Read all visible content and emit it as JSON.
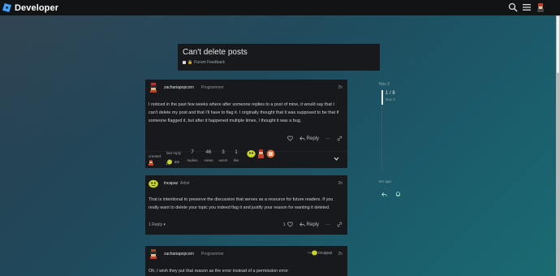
{
  "header": {
    "brand": "Developer",
    "icons": [
      "search-icon",
      "hamburger-menu-icon",
      "user-avatar"
    ]
  },
  "topic": {
    "title": "Can't delete posts",
    "category": "Forum Feedback"
  },
  "posts": [
    {
      "username": "zachariapopcorn",
      "user_title": "Programmer",
      "time": "2h",
      "body": "I noticed in the past few weeks where after someone replies to a post of mine, it would say that I can't delete my post and that I'll have to flag it. I originally thought that it was supposed to be that if someone flagged it, but after it happened multiple times, I thought it was a bug.",
      "reply_label": "Reply"
    },
    {
      "username": "incapaz",
      "user_title": "Artist",
      "time": "2h",
      "body": "That is intentional to preserve the discussion that serves as a resource for future readers. If you really want to delete your topic you indeed flag it and justify your reason for wanting it deleted.",
      "replies_toggle": "1 Reply",
      "like_count": "1",
      "reply_label": "Reply"
    },
    {
      "username": "zachariapopcorn",
      "user_title": "Programmer",
      "time": "2h",
      "reply_to": "incapaz",
      "body": "Oh, I wish they put that reason as the error instead of a permission error"
    }
  ],
  "topic_meta": {
    "created_label": "created",
    "created_time": "1h",
    "last_reply_label": "last reply",
    "last_reply_time": "6m",
    "stats": [
      {
        "value": "7",
        "label": "replies"
      },
      {
        "value": "46",
        "label": "views"
      },
      {
        "value": "3",
        "label": "users"
      },
      {
        "value": "1",
        "label": "like"
      }
    ]
  },
  "timeline": {
    "start_date": "Nov 2",
    "position": "1 / 8",
    "current_date": "Nov 3",
    "end_label": "6m ago"
  },
  "colors": {
    "background_accent": "#1b5a6a",
    "panel": "#17191c",
    "header": "#121314",
    "brand_blue": "#3fa0ff"
  }
}
